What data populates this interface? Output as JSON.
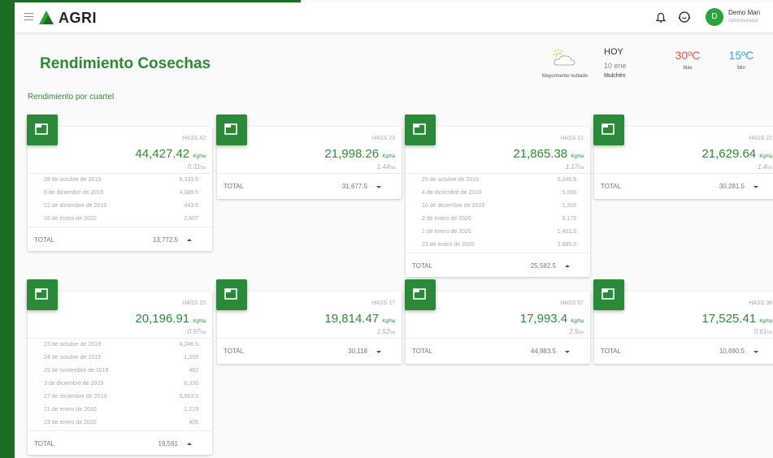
{
  "app": {
    "name": "AGRI"
  },
  "user": {
    "initial": "D",
    "name": "Demo Man",
    "role": "Administrador"
  },
  "page": {
    "title": "Rendimiento Cosechas",
    "section": "Rendimiento por cuartel"
  },
  "weather": {
    "description": "Mayormente nublado",
    "today_label": "HOY",
    "date": "10 ene",
    "location": "Mulchén",
    "max": "30ºC",
    "max_label": "Máx",
    "min": "15ºC",
    "min_label": "Min"
  },
  "colors": {
    "brand": "#2e8b35",
    "sidebar": "#1e6b23",
    "max_temp": "#e55454",
    "min_temp": "#4a9de0"
  },
  "labels": {
    "total": "TOTAL",
    "yield_unit": "Kg/ha",
    "area_unit": "ha"
  },
  "cards": [
    {
      "name": "HASS 42",
      "yield": "44,427.42",
      "area": "0.31",
      "expanded": true,
      "rows": [
        {
          "date": "28 de octubre de 2019",
          "value": "6,333.5"
        },
        {
          "date": "6 de diciembre de 2019",
          "value": "4,388.5"
        },
        {
          "date": "12 de diciembre de 2019",
          "value": "443.5"
        },
        {
          "date": "16 de enero de 2020",
          "value": "2,607"
        }
      ],
      "total": "13,772.5"
    },
    {
      "name": "HASS 23",
      "yield": "21,998.26",
      "area": "1.44",
      "expanded": false,
      "rows": [],
      "total": "31,677.5"
    },
    {
      "name": "HASS 21",
      "yield": "21,865.38",
      "area": "1.17",
      "expanded": true,
      "rows": [
        {
          "date": "25 de octubre de 2019",
          "value": "5,245.5"
        },
        {
          "date": "4 de diciembre de 2019",
          "value": "5,566"
        },
        {
          "date": "10 de diciembre de 2019",
          "value": "1,309"
        },
        {
          "date": "2 de enero de 2020",
          "value": "9,175"
        },
        {
          "date": "1 de enero de 2020",
          "value": "1,401.5"
        },
        {
          "date": "23 de enero de 2020",
          "value": "2,885.5"
        }
      ],
      "total": "25,582.5"
    },
    {
      "name": "HASS 22",
      "yield": "21,629.64",
      "area": "1.4",
      "expanded": false,
      "rows": [],
      "total": "30,281.5"
    },
    {
      "name": "HASS 15",
      "yield": "20,196.91",
      "area": "0.97",
      "expanded": true,
      "rows": [
        {
          "date": "23 de octubre de 2019",
          "value": "4,246.5"
        },
        {
          "date": "24 de octubre de 2019",
          "value": "1,359"
        },
        {
          "date": "29 de noviembre de 2019",
          "value": "462"
        },
        {
          "date": "3 de diciembre de 2019",
          "value": "6,336"
        },
        {
          "date": "27 de diciembre de 2019",
          "value": "5,563.5"
        },
        {
          "date": "21 de enero de 2020",
          "value": "1,219"
        },
        {
          "date": "23 de enero de 2020",
          "value": "405"
        }
      ],
      "total": "19,591"
    },
    {
      "name": "HASS 17",
      "yield": "19,814.47",
      "area": "1.52",
      "expanded": false,
      "rows": [],
      "total": "30,118"
    },
    {
      "name": "HASS 57",
      "yield": "17,993.4",
      "area": "2.5",
      "expanded": false,
      "rows": [],
      "total": "44,983.5"
    },
    {
      "name": "HASS 36",
      "yield": "17,525.41",
      "area": "0.61",
      "expanded": false,
      "rows": [],
      "total": "10,690.5"
    }
  ]
}
